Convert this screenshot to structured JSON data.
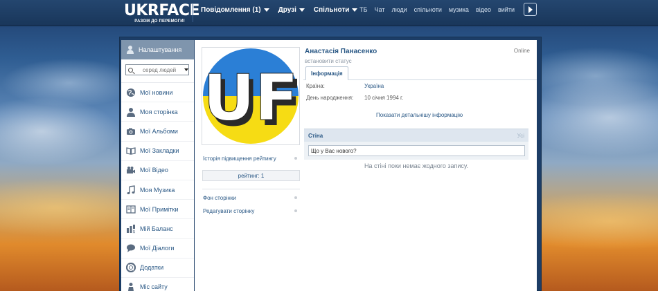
{
  "brand": {
    "logo": "UKRFACE",
    "tagline": "РАЗОМ ДО ПЕРЕМОГИ!"
  },
  "topnav": {
    "left": [
      {
        "label": "Повідомлення (1)",
        "has_caret": true
      },
      {
        "label": "Друзі",
        "has_caret": true
      },
      {
        "label": "Спільноти",
        "has_caret": true
      }
    ],
    "right": [
      "ТБ",
      "Чат",
      "люди",
      "спільноти",
      "музика",
      "відео",
      "вийти"
    ],
    "play_icon": "play-icon"
  },
  "sidebar": {
    "header": "Налаштування",
    "search_placeholder": "серед людей",
    "items": [
      {
        "label": "Мої новини",
        "icon": "globe-icon"
      },
      {
        "label": "Моя сторінка",
        "icon": "user-icon"
      },
      {
        "label": "Мої Альбоми",
        "icon": "camera-icon"
      },
      {
        "label": "Мої Закладки",
        "icon": "book-icon"
      },
      {
        "label": "Мої Відео",
        "icon": "video-camera-icon"
      },
      {
        "label": "Моя Музика",
        "icon": "music-note-icon"
      },
      {
        "label": "Мої Примітки",
        "icon": "notebook-icon"
      },
      {
        "label": "Мій Баланс",
        "icon": "balance-icon"
      },
      {
        "label": "Мої Діалоги",
        "icon": "speech-bubble-icon"
      },
      {
        "label": "Додатки",
        "icon": "lifebuoy-icon"
      },
      {
        "label": "Міс сайту",
        "icon": "person-icon"
      }
    ]
  },
  "profile": {
    "avatar_text": "UF",
    "avatar_colors": {
      "top": "#2b7fd6",
      "bottom": "#f6dc14"
    },
    "name": "Анастасія Панасенко",
    "status": "встановити статус",
    "online": "Online",
    "tab": "Інформація",
    "info": [
      {
        "label": "Країна:",
        "value": "Україна"
      },
      {
        "label": "День народження:",
        "value": "10 січня 1994 г."
      }
    ],
    "more_link": "Показати детальнішу інформацію",
    "rating_history": "Історія підвищення рейтингу",
    "rating": "рейтинг: 1",
    "bg_link": "Фон сторінки",
    "edit_link": "Редагувати сторінку"
  },
  "wall": {
    "title": "Стіна",
    "all": "Усі",
    "input_value": "Що у Вас нового?",
    "empty": "На стіні поки немає жодного запису."
  }
}
